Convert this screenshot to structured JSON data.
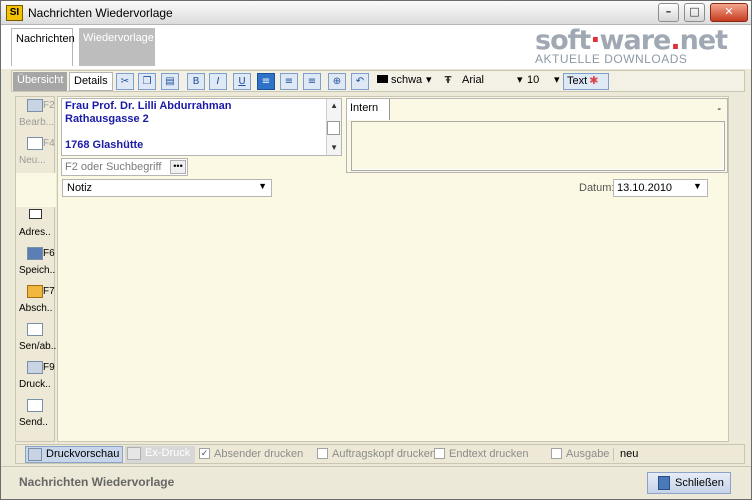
{
  "window": {
    "title": "Nachrichten Wiedervorlage",
    "app_icon": "SI"
  },
  "controls": {
    "minimize": "–",
    "maximize": "□",
    "close": "✕"
  },
  "top_tabs": [
    {
      "label": "Nachrichten"
    },
    {
      "label": "Wiedervorlage"
    }
  ],
  "logo": {
    "brand_a": "soft",
    "brand_sep": "·",
    "brand_b": "ware",
    "brand_dot": ".",
    "brand_c": "net",
    "sub": "AKTUELLE DOWNLOADS"
  },
  "toolbar": {
    "tab_uebersicht": "Übersicht",
    "tab_details": "Details",
    "bold": "B",
    "italic": "I",
    "underline": "U",
    "color_value": "schwa",
    "font_value": "Arial",
    "size_value": "10",
    "text_label": "Text"
  },
  "left_buttons": [
    {
      "key": "F2",
      "label": "Bearb..."
    },
    {
      "key": "F4",
      "label": "Neu..."
    },
    {
      "key": "",
      "label": "Adres.."
    },
    {
      "key": "F6",
      "label": "Speich.."
    },
    {
      "key": "F7",
      "label": "Absch.."
    },
    {
      "key": "",
      "label": "Sen/ab.."
    },
    {
      "key": "F9",
      "label": "Druck.."
    },
    {
      "key": "",
      "label": "Send.."
    }
  ],
  "address": {
    "lines": [
      "Frau Prof. Dr. Lilli Abdurrahman",
      "Rathausgasse 2",
      "",
      "1768 Glashütte"
    ]
  },
  "search": {
    "placeholder": "F2 oder Suchbegriff",
    "btn": "•••"
  },
  "intern": {
    "tab": "Intern",
    "dash": "-"
  },
  "notiz": {
    "value": "Notiz"
  },
  "datum": {
    "label": "Datum:",
    "value": "13.10.2010"
  },
  "bottom": {
    "druckvorschau": "Druckvorschau",
    "ex_druck": "Ex-Druck",
    "absender": "Absender drucken",
    "auftragskopf": "Auftragskopf drucken",
    "endtext": "Endtext drucken",
    "ausgabe": "Ausgabe",
    "neu": "neu"
  },
  "status": {
    "text": "Nachrichten Wiedervorlage",
    "close_label": "Schließen"
  }
}
